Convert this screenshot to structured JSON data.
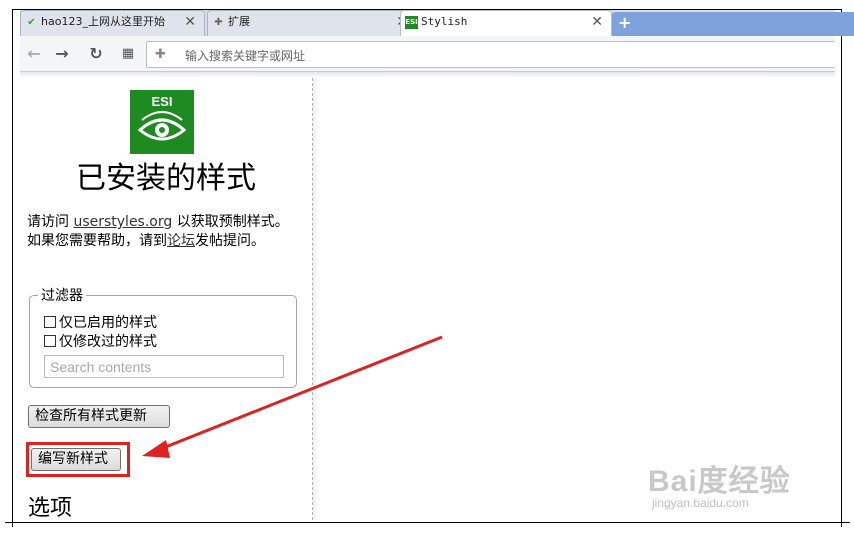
{
  "browser": {
    "tabs": [
      {
        "label": "hao123_上网从这里开始",
        "icon": "hao123-icon",
        "active": false
      },
      {
        "label": "扩展",
        "icon": "puzzle-icon",
        "active": false
      },
      {
        "label": "Stylish",
        "icon": "esi-icon",
        "active": true
      }
    ],
    "close_glyph": "✕",
    "new_tab_glyph": "+",
    "omnibox_placeholder": "输入搜索关键字或网址"
  },
  "page": {
    "logo_text": "ESI",
    "title": "已安装的样式",
    "intro_prefix": "请访问 ",
    "intro_link": "userstyles.org",
    "intro_middle": " 以获取预制样式。如果您需要帮助，请到",
    "intro_forum_link": "论坛",
    "intro_suffix": "发帖提问。",
    "filter": {
      "legend": "过滤器",
      "option_enabled": "仅已启用的样式",
      "option_edited": "仅修改过的样式",
      "search_placeholder": "Search contents"
    },
    "check_updates_button": "检查所有样式更新",
    "write_new_button": "编写新样式",
    "options_heading": "选项"
  },
  "watermark": {
    "main": "Bai度经验",
    "sub": "jingyan.baidu.com"
  },
  "colors": {
    "accent_red": "#d22222",
    "logo_green": "#1d8a22",
    "newtab_blue": "#7ea3dc"
  }
}
